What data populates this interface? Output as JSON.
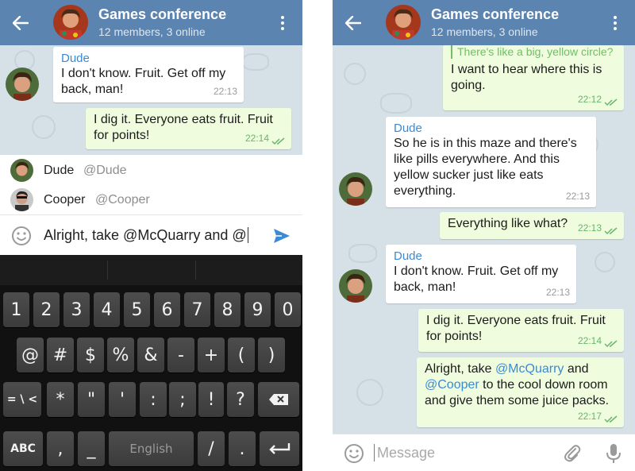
{
  "header": {
    "title": "Games conference",
    "subtitle": "12 members, 3 online"
  },
  "left": {
    "messages": [
      {
        "sender": "Dude",
        "text": "I don't know. Fruit. Get off my back, man!",
        "time": "22:13",
        "direction": "in"
      },
      {
        "text": "I dig it. Everyone eats fruit. Fruit for points!",
        "time": "22:14",
        "direction": "out",
        "status": "read"
      }
    ],
    "mentions": [
      {
        "name": "Dude",
        "username": "@Dude"
      },
      {
        "name": "Cooper",
        "username": "@Cooper"
      }
    ],
    "input_value": "Alright, take @McQuarry and @",
    "keyboard": {
      "row1": [
        "1",
        "2",
        "3",
        "4",
        "5",
        "6",
        "7",
        "8",
        "9",
        "0"
      ],
      "row2": [
        "@",
        "#",
        "$",
        "%",
        "&",
        "-",
        "+",
        "(",
        ")"
      ],
      "row3": [
        "= \\ <",
        "*",
        "\"",
        "'",
        ":",
        ";",
        "!",
        "?"
      ],
      "abc_label": "ABC",
      "comma": ",",
      "underscore": "_",
      "space_label": "English",
      "slash": "/",
      "period": "."
    }
  },
  "right": {
    "messages": [
      {
        "reply_quote": "There's like a big, yellow circle?",
        "text": "I want to hear where this is going.",
        "time": "22:12",
        "direction": "out",
        "status": "read"
      },
      {
        "sender": "Dude",
        "text": "So he is in this maze and there's like pills everywhere. And this yellow sucker just like eats everything.",
        "time": "22:13",
        "direction": "in"
      },
      {
        "text": "Everything like what?",
        "time": "22:13",
        "direction": "out",
        "status": "read"
      },
      {
        "sender": "Dude",
        "text": "I don't know. Fruit. Get off my back, man!",
        "time": "22:13",
        "direction": "in"
      },
      {
        "text": "I dig it. Everyone eats fruit. Fruit for points!",
        "time": "22:14",
        "direction": "out",
        "status": "read"
      },
      {
        "text_parts": [
          "Alright, take ",
          "@McQuarry",
          " and ",
          "@Cooper",
          " to the cool down room and give them some juice packs."
        ],
        "time": "22:17",
        "direction": "out",
        "status": "read"
      }
    ],
    "input_placeholder": "Message"
  },
  "colors": {
    "header": "#5b84b1",
    "chat_background": "#d6e0e7",
    "incoming_bubble": "#ffffff",
    "outgoing_bubble": "#effdde",
    "accent": "#3a8ad6",
    "send_button": "#3a8ad6",
    "read_check": "#68b66d",
    "keyboard": "#111111"
  },
  "icons": {
    "back": "back-arrow-icon",
    "menu": "more-vertical-icon",
    "emoji": "smiley-icon",
    "send": "send-arrow-icon",
    "attach": "paperclip-icon",
    "mic": "microphone-icon",
    "backspace": "backspace-icon",
    "enter": "enter-icon"
  }
}
